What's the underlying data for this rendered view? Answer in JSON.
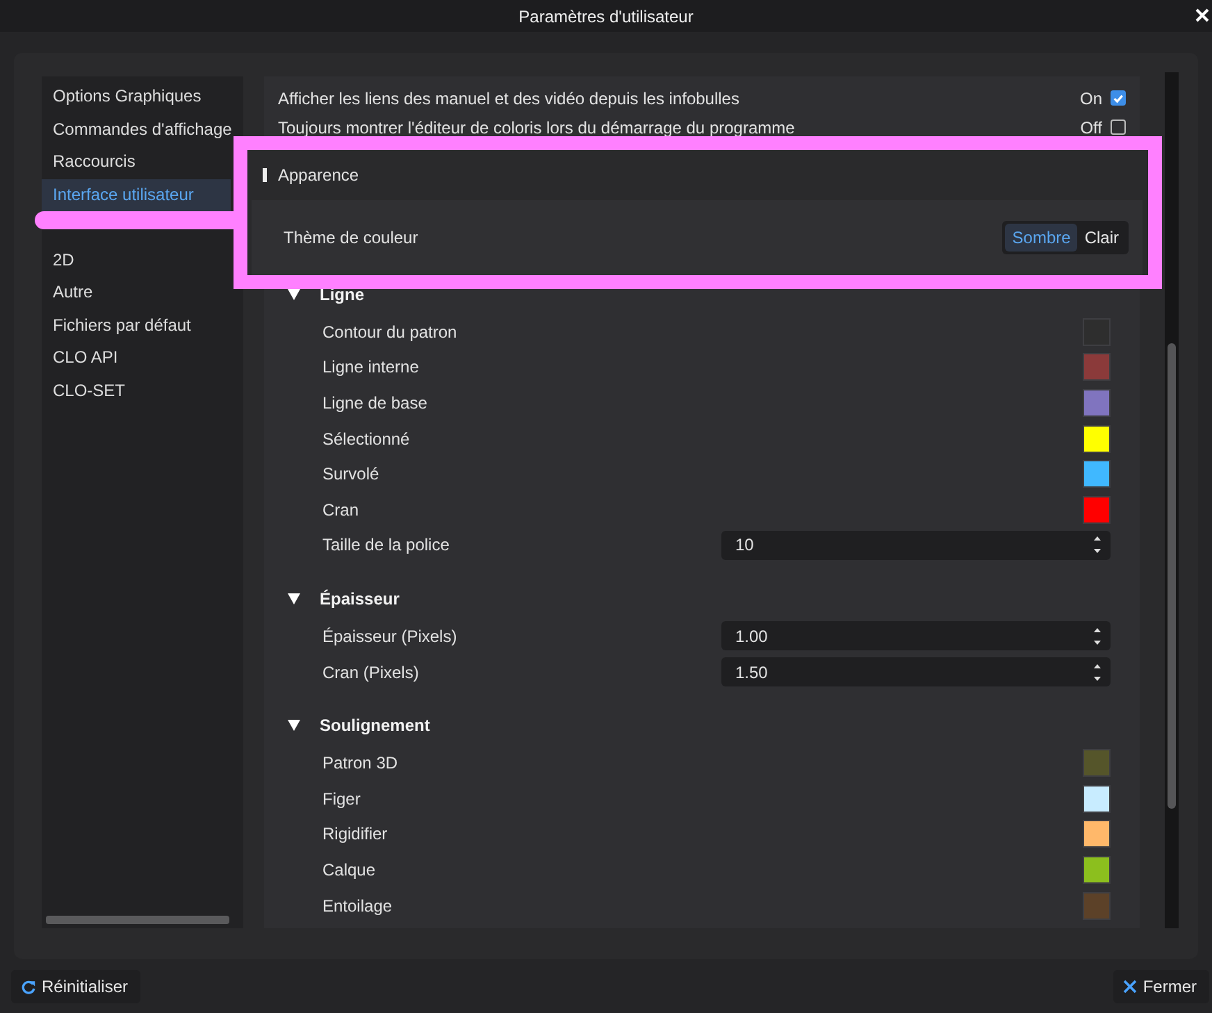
{
  "window": {
    "title": "Paramètres d'utilisateur"
  },
  "sidebar": {
    "items": [
      {
        "label": "Options Graphiques",
        "selected": false
      },
      {
        "label": "Commandes d'affichage",
        "selected": false
      },
      {
        "label": "Raccourcis",
        "selected": false
      },
      {
        "label": "Interface utilisateur",
        "selected": true
      },
      {
        "label": "2D",
        "selected": false
      },
      {
        "label": "Autre",
        "selected": false
      },
      {
        "label": "Fichiers par défaut",
        "selected": false
      },
      {
        "label": "CLO API",
        "selected": false
      },
      {
        "label": "CLO-SET",
        "selected": false
      }
    ]
  },
  "options": [
    {
      "label": "Afficher les liens des manuel et des vidéo depuis les infobulles",
      "state": "On",
      "checked": true
    },
    {
      "label": "Toujours montrer l'éditeur de coloris lors du démarrage du programme",
      "state": "Off",
      "checked": false
    }
  ],
  "highlight": {
    "section": "Apparence",
    "row_label": "Thème de couleur",
    "choices": [
      {
        "label": "Sombre",
        "selected": true
      },
      {
        "label": "Clair",
        "selected": false
      }
    ]
  },
  "sections": [
    {
      "title": "Ligne",
      "expanded": true,
      "rows": [
        {
          "label": "Contour du patron",
          "kind": "color",
          "color": "#2e2e2e"
        },
        {
          "label": "Ligne interne",
          "kind": "color",
          "color": "#8b3a3a"
        },
        {
          "label": "Ligne de base",
          "kind": "color",
          "color": "#8074bf"
        },
        {
          "label": "Sélectionné",
          "kind": "color",
          "color": "#ffff00"
        },
        {
          "label": "Survolé",
          "kind": "color",
          "color": "#40b8ff"
        },
        {
          "label": "Cran",
          "kind": "color",
          "color": "#ff0000"
        },
        {
          "label": "Taille de la police",
          "kind": "spin",
          "value": "10"
        }
      ]
    },
    {
      "title": "Épaisseur",
      "expanded": true,
      "rows": [
        {
          "label": "Épaisseur (Pixels)",
          "kind": "spin",
          "value": "1.00"
        },
        {
          "label": "Cran (Pixels)",
          "kind": "spin",
          "value": "1.50"
        }
      ]
    },
    {
      "title": "Soulignement",
      "expanded": true,
      "rows": [
        {
          "label": "Patron 3D",
          "kind": "color",
          "color": "#55552a"
        },
        {
          "label": "Figer",
          "kind": "color",
          "color": "#c8ecff"
        },
        {
          "label": "Rigidifier",
          "kind": "color",
          "color": "#ffb86a"
        },
        {
          "label": "Calque",
          "kind": "color",
          "color": "#8cbf1e"
        },
        {
          "label": "Entoilage",
          "kind": "color",
          "color": "#5c4128"
        }
      ]
    }
  ],
  "buttons": {
    "reset": "Réinitialiser",
    "close": "Fermer"
  }
}
